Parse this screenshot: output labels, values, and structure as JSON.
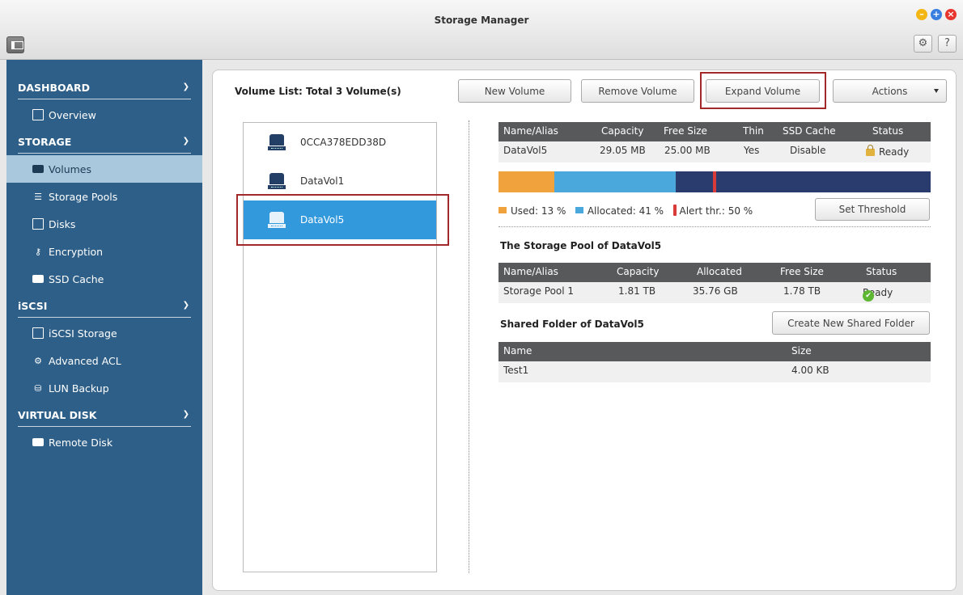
{
  "window": {
    "title": "Storage Manager"
  },
  "sidebar": {
    "sections": [
      {
        "title": "DASHBOARD",
        "items": [
          {
            "label": "Overview",
            "icon": "overview-icon"
          }
        ]
      },
      {
        "title": "STORAGE",
        "items": [
          {
            "label": "Volumes",
            "icon": "drive-icon",
            "active": true
          },
          {
            "label": "Storage Pools",
            "icon": "list-icon"
          },
          {
            "label": "Disks",
            "icon": "disk-icon"
          },
          {
            "label": "Encryption",
            "icon": "key-icon"
          },
          {
            "label": "SSD Cache",
            "icon": "ssd-icon"
          }
        ]
      },
      {
        "title": "iSCSI",
        "items": [
          {
            "label": "iSCSI Storage",
            "icon": "iscsi-icon"
          },
          {
            "label": "Advanced ACL",
            "icon": "gear-icon"
          },
          {
            "label": "LUN Backup",
            "icon": "backup-icon"
          }
        ]
      },
      {
        "title": "VIRTUAL DISK",
        "items": [
          {
            "label": "Remote Disk",
            "icon": "remote-disk-icon"
          }
        ]
      }
    ]
  },
  "toolbar": {
    "volume_list_title": "Volume List: Total 3 Volume(s)",
    "new_volume": "New Volume",
    "remove_volume": "Remove Volume",
    "expand_volume": "Expand Volume",
    "actions": "Actions"
  },
  "volumes": [
    {
      "name": "0CCA378EDD38D"
    },
    {
      "name": "DataVol1"
    },
    {
      "name": "DataVol5",
      "selected": true
    }
  ],
  "volume_table": {
    "headers": [
      "Name/Alias",
      "Capacity",
      "Free Size",
      "Thin",
      "SSD Cache",
      "Status"
    ],
    "row": [
      "DataVol5",
      "29.05 MB",
      "25.00 MB",
      "Yes",
      "Disable",
      "Ready"
    ]
  },
  "usage": {
    "used_percent": 13,
    "allocated_percent": 41,
    "alert_threshold_percent": 50,
    "used_label": "Used: 13 %",
    "allocated_label": "Allocated: 41 %",
    "alert_label": "Alert thr.: 50 %",
    "set_threshold": "Set Threshold",
    "colors": {
      "used": "#f0a23c",
      "allocated": "#4aa8dc",
      "alert": "#d93b3b",
      "free": "#2a3c6e"
    }
  },
  "pool": {
    "title": "The Storage Pool of DataVol5",
    "headers": [
      "Name/Alias",
      "Capacity",
      "Allocated",
      "Free Size",
      "Status"
    ],
    "row": [
      "Storage Pool 1",
      "1.81 TB",
      "35.76 GB",
      "1.78 TB",
      "Ready"
    ]
  },
  "shared": {
    "title": "Shared Folder of DataVol5",
    "create_button": "Create New Shared Folder",
    "headers": [
      "Name",
      "Size"
    ],
    "row": [
      "Test1",
      "4.00 KB"
    ]
  }
}
